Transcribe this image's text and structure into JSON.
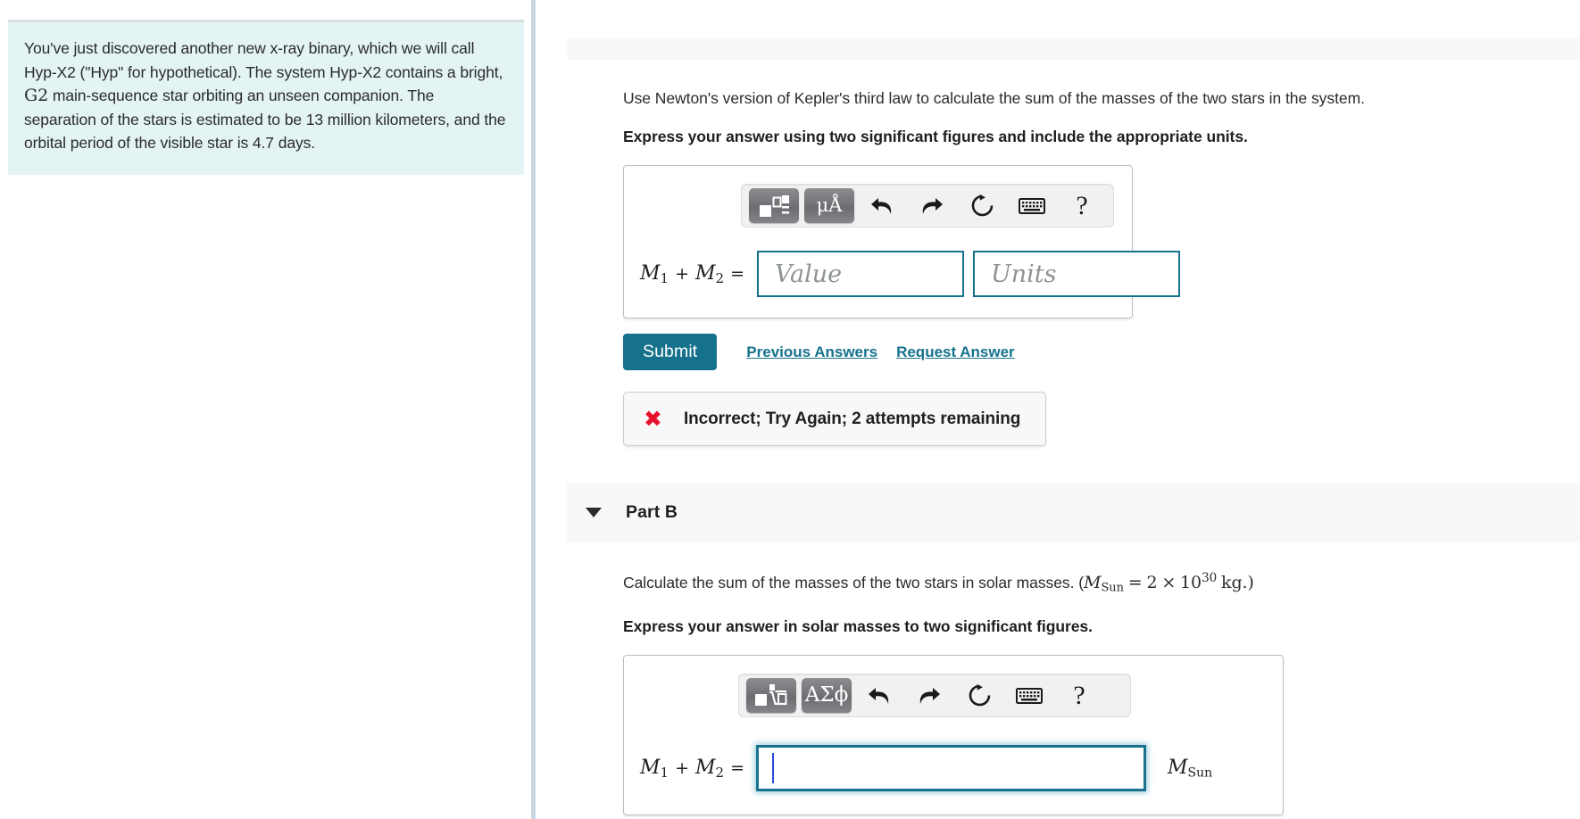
{
  "problem": {
    "text_segments": [
      "You've just discovered another new x-ray binary, which we will call Hyp-X2 (\"Hyp\" for hypothetical). The system Hyp-X2 contains a bright, ",
      "G2",
      " main-sequence star orbiting an unseen companion. The separation of the stars is estimated to be 13 million kilometers, and the orbital period of the visible star is 4.7 days."
    ],
    "full_text": "You've just discovered another new x-ray binary, which we will call Hyp-X2 (\"Hyp\" for hypothetical). The system Hyp-X2 contains a bright, G2 main-sequence star orbiting an unseen companion. The separation of the stars is estimated to be 13 million kilometers, and the orbital period of the visible star is 4.7 days.",
    "spectral_type": "G2",
    "separation": "13 million kilometers",
    "orbital_period": "4.7 days",
    "background_color": "#e4f4f4"
  },
  "part_a": {
    "question": "Use Newton's version of Kepler's third law to calculate the sum of the masses of the two stars in the system.",
    "instruction": "Express your answer using two significant figures and include the appropriate units.",
    "toolbar": {
      "template_button_label": "",
      "units_button_label": "μÅ",
      "undo_label": "⮌",
      "redo_label": "⮊",
      "reset_label": "↻",
      "keyboard_label": "keyboard",
      "help_label": "?"
    },
    "lhs": {
      "m1": "M",
      "m1_sub": "1",
      "plus": "+",
      "m2": "M",
      "m2_sub": "2",
      "equals": "="
    },
    "value_placeholder": "Value",
    "value_current": "",
    "units_placeholder": "Units",
    "units_current": "",
    "submit_label": "Submit",
    "previous_answers_label": "Previous Answers",
    "request_answer_label": "Request Answer",
    "feedback": {
      "icon": "x-mark-icon",
      "message": "Incorrect; Try Again; 2 attempts remaining",
      "icon_color": "#e8112d"
    }
  },
  "part_b": {
    "header_label": "Part B",
    "expanded": true,
    "question_prefix": "Calculate the sum of the masses of the two stars in solar masses. (",
    "msun_symbol": "M",
    "msun_sub": "Sun",
    "equals": "=",
    "msun_value_mantissa": "2",
    "msun_times": "×",
    "msun_base": "10",
    "msun_exponent": "30",
    "msun_unit": "kg.)",
    "instruction": "Express your answer in solar masses to two significant figures.",
    "toolbar": {
      "template_button_label": "nth-root-template",
      "greek_button_label": "ΑΣϕ",
      "undo_label": "⮌",
      "redo_label": "⮊",
      "reset_label": "↻",
      "keyboard_label": "keyboard",
      "help_label": "?"
    },
    "lhs": {
      "m1": "M",
      "m1_sub": "1",
      "plus": "+",
      "m2": "M",
      "m2_sub": "2",
      "equals": "="
    },
    "answer_current": "",
    "answer_placeholder": "",
    "unit_suffix_symbol": "M",
    "unit_suffix_sub": "Sun"
  },
  "theme": {
    "accent": "#16728c",
    "link": "#16728c",
    "error": "#e8112d",
    "panel_bg": "#f7f8f8",
    "rule": "#c7d8e6"
  }
}
